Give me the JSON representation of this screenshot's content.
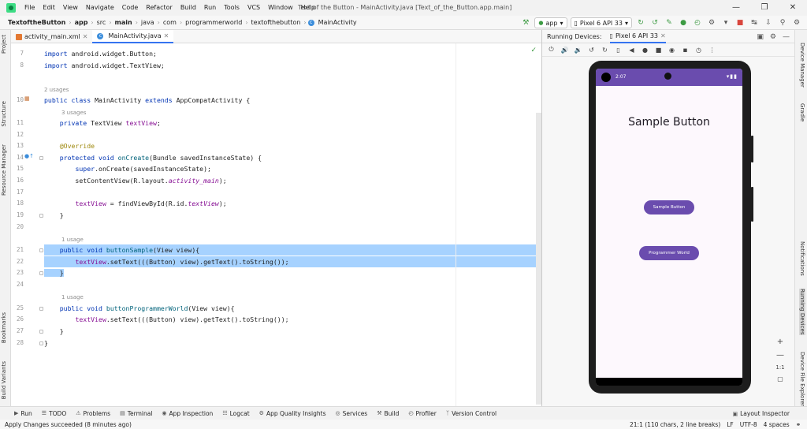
{
  "menubar": {
    "items": [
      "File",
      "Edit",
      "View",
      "Navigate",
      "Code",
      "Refactor",
      "Build",
      "Run",
      "Tools",
      "VCS",
      "Window",
      "Help"
    ],
    "window_title": "Text of the Button - MainActivity.java [Text_of_the_Button.app.main]"
  },
  "navbar": {
    "crumbs": [
      "TextoftheButton",
      "app",
      "src",
      "main",
      "java",
      "com",
      "programmerworld",
      "textofthebutton",
      "MainActivity"
    ],
    "run_config": "app",
    "device": "Pixel 6 API 33"
  },
  "left_strip": [
    "Project",
    "Structure",
    "Resource Manager",
    "Bookmarks",
    "Build Variants"
  ],
  "right_strip": [
    "Device Manager",
    "Gradle",
    "Notifications",
    "Running Devices",
    "Device File Explorer"
  ],
  "file_tabs": [
    "activity_main.xml",
    "MainActivity.java"
  ],
  "editor": {
    "usage_hints": [
      "2 usages",
      "3 usages",
      "1 usage",
      "1 usage"
    ],
    "line_numbers": [
      "7",
      "8",
      "10",
      "11",
      "12",
      "13",
      "14",
      "15",
      "16",
      "17",
      "18",
      "19",
      "20",
      "21",
      "22",
      "23",
      "24",
      "25",
      "26",
      "27",
      "28"
    ]
  },
  "devices": {
    "label": "Running Devices:",
    "tab": "Pixel 6 API 33",
    "status_time": "2:07",
    "app_title": "Sample Button",
    "button1": "Sample Button",
    "button2": "Programmer World",
    "zoom_ratio": "1:1"
  },
  "toolwindows": [
    "Run",
    "TODO",
    "Problems",
    "Terminal",
    "App Inspection",
    "Logcat",
    "App Quality Insights",
    "Services",
    "Build",
    "Profiler",
    "Version Control"
  ],
  "layout_inspector": "Layout Inspector",
  "status": {
    "message": "Apply Changes succeeded (8 minutes ago)",
    "position": "21:1 (110 chars, 2 line breaks)",
    "line_sep": "LF",
    "encoding": "UTF-8",
    "indent": "4 spaces"
  }
}
